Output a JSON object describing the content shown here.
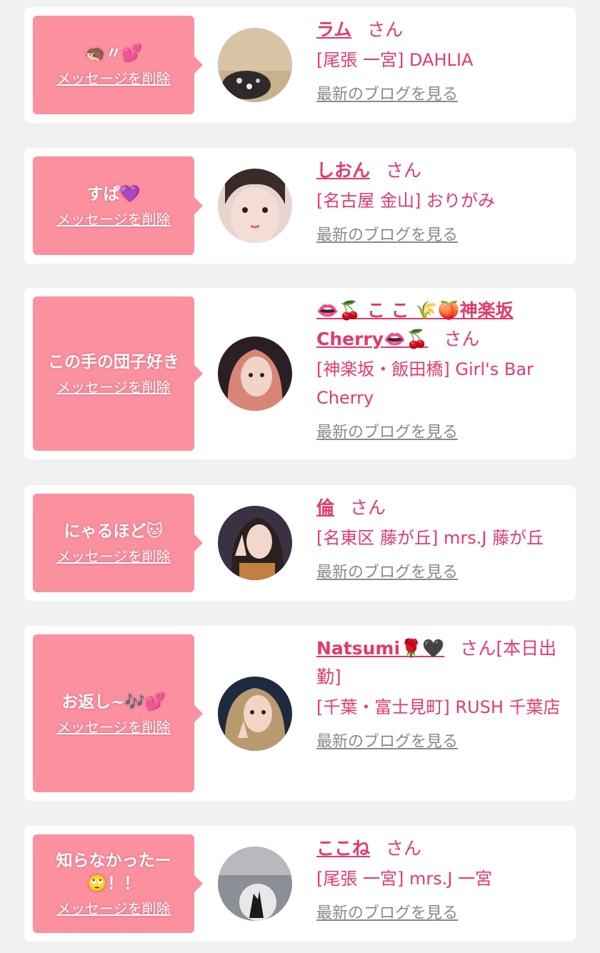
{
  "colors": {
    "accent": "#e23a6e",
    "bubble": "#fb909f",
    "muted_link": "#8a8a8a",
    "background": "#f1f1f1"
  },
  "common": {
    "delete_label": "メッセージを削除",
    "blog_label": "最新のブログを見る",
    "san": "さん"
  },
  "messages": [
    {
      "message": "🦔〃💕",
      "name": "ラム",
      "shop": "[尾張 一宮] DAHLIA"
    },
    {
      "message": "すぱ💜",
      "name": "しおん",
      "shop": "[名古屋 金山] おりがみ"
    },
    {
      "message": "この手の団子好き",
      "name": "👄🍒 こ こ 🌾🍑神楽坂 Cherry👄🍒",
      "shop": "[神楽坂・飯田橋] Girl's Bar Cherry"
    },
    {
      "message": "にゃるほど🐱",
      "name": "倫",
      "shop": "[名東区 藤が丘] mrs.J 藤が丘"
    },
    {
      "message": "お返し~🎶💕",
      "name": "Natsumi🌹🖤",
      "san_suffix": "[本日出勤]",
      "shop": "[千葉・富士見町] RUSH 千葉店"
    },
    {
      "message": "知らなかったー🙄！！",
      "name": "ここね",
      "shop": "[尾張 一宮] mrs.J 一宮"
    }
  ]
}
